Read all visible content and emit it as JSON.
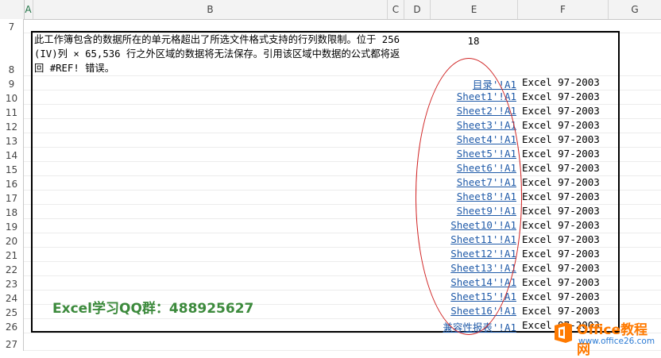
{
  "columns": [
    "A",
    "B",
    "C",
    "D",
    "E",
    "F",
    "G"
  ],
  "selected_column": "A",
  "rows": [
    "7",
    "8",
    "9",
    "10",
    "11",
    "12",
    "13",
    "14",
    "15",
    "16",
    "17",
    "18",
    "19",
    "20",
    "21",
    "22",
    "23",
    "24",
    "25",
    "26",
    "27"
  ],
  "message": "此工作簿包含的数据所在的单元格超出了所选文件格式支持的行列数限制。位于 256 (IV)列 × 65,536 行之外区域的数据将无法保存。引用该区域中数据的公式都将返回 #REF! 错误。",
  "count": "18",
  "links": [
    {
      "link": "目录'!A1",
      "version": "Excel 97-2003"
    },
    {
      "link": "Sheet1'!A1",
      "version": "Excel 97-2003"
    },
    {
      "link": "Sheet2'!A1",
      "version": "Excel 97-2003"
    },
    {
      "link": "Sheet3'!A1",
      "version": "Excel 97-2003"
    },
    {
      "link": "Sheet4'!A1",
      "version": "Excel 97-2003"
    },
    {
      "link": "Sheet5'!A1",
      "version": "Excel 97-2003"
    },
    {
      "link": "Sheet6'!A1",
      "version": "Excel 97-2003"
    },
    {
      "link": "Sheet7'!A1",
      "version": "Excel 97-2003"
    },
    {
      "link": "Sheet8'!A1",
      "version": "Excel 97-2003"
    },
    {
      "link": "Sheet9'!A1",
      "version": "Excel 97-2003"
    },
    {
      "link": "Sheet10'!A1",
      "version": "Excel 97-2003"
    },
    {
      "link": "Sheet11'!A1",
      "version": "Excel 97-2003"
    },
    {
      "link": "Sheet12'!A1",
      "version": "Excel 97-2003"
    },
    {
      "link": "Sheet13'!A1",
      "version": "Excel 97-2003"
    },
    {
      "link": "Sheet14'!A1",
      "version": "Excel 97-2003"
    },
    {
      "link": "Sheet15'!A1",
      "version": "Excel 97-2003"
    },
    {
      "link": "Sheet16'!A1",
      "version": "Excel 97-2003"
    },
    {
      "link": "兼容性报表'!A1",
      "version": "Excel 97-2003"
    }
  ],
  "qq_group": "Excel学习QQ群：488925627",
  "watermark": {
    "title": "Office教程网",
    "url": "www.office26.com"
  },
  "colors": {
    "link": "#1f5aa8",
    "ellipse": "#d02424",
    "qq_text": "#3c8a3c",
    "watermark_orange": "#ff7a00",
    "selected_header": "#217346"
  }
}
